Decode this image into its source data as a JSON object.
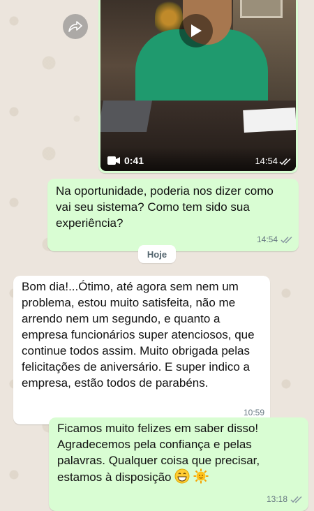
{
  "video_message": {
    "duration": "0:41",
    "time": "14:54",
    "icons": {
      "forward": "forward-icon",
      "play": "play-icon",
      "camera": "video-camera-icon",
      "ticks": "double-check-icon"
    }
  },
  "messages": [
    {
      "direction": "outgoing",
      "text": "Na oportunidade, poderia nos dizer como vai seu sistema? Como tem sido sua experiência?",
      "time": "14:54",
      "status": "read"
    },
    {
      "direction": "incoming",
      "text": "Bom dia!...Ótimo, até agora sem nem um problema, estou muito satisfeita, não me arrendo nem um segundo, e quanto a empresa funcionários super atenciosos, que continue todos assim. Muito obrigada pelas felicitações  de aniversário. E super indico a empresa, estão todos de parabéns.",
      "time": "10:59"
    },
    {
      "direction": "outgoing",
      "text": "Ficamos muito felizes em saber disso! Agradecemos pela confiança e pelas palavras. Qualquer coisa que precisar, estamos à disposição",
      "emojis": [
        "grinning-face-emoji",
        "sun-emoji"
      ],
      "time": "13:18",
      "status": "read"
    }
  ],
  "date_divider": "Hoje",
  "colors": {
    "outgoing_bubble": "#d9fdd3",
    "incoming_bubble": "#ffffff",
    "tick_read": "#8696a0",
    "wallpaper": "#ece5dd"
  }
}
